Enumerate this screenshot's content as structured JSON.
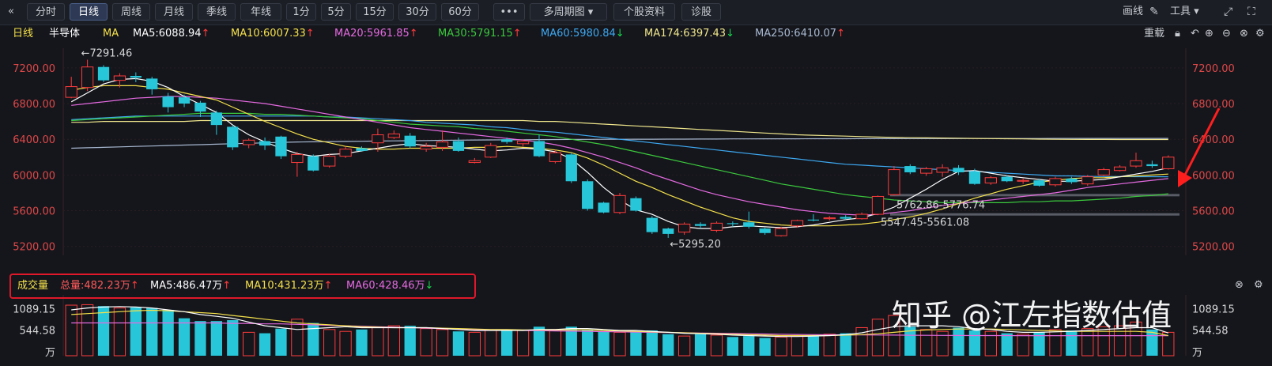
{
  "toolbar": {
    "collapse_icon": "«",
    "buttons": [
      "分时",
      "日线",
      "周线",
      "月线",
      "季线",
      "年线",
      "1分",
      "5分",
      "15分",
      "30分",
      "60分",
      "•••",
      "多周期图 ▾",
      "个股资料",
      "诊股"
    ],
    "active": "日线",
    "right": {
      "draw": "画线",
      "tools": "工具 ▾"
    }
  },
  "ma_header": {
    "period": "日线",
    "name": "半导体",
    "ma_label": "MA",
    "items": [
      {
        "label": "MA5:6088.94",
        "color": "#ffffff",
        "arrow": "↑",
        "dir": "up"
      },
      {
        "label": "MA10:6007.33",
        "color": "#f5e04a",
        "arrow": "↑",
        "dir": "up"
      },
      {
        "label": "MA20:5961.85",
        "color": "#e66ae0",
        "arrow": "↑",
        "dir": "up"
      },
      {
        "label": "MA30:5791.15",
        "color": "#3cc93c",
        "arrow": "↑",
        "dir": "up"
      },
      {
        "label": "MA60:5980.84",
        "color": "#3ea8f0",
        "arrow": "↓",
        "dir": "down"
      },
      {
        "label": "MA174:6397.43",
        "color": "#f0e68c",
        "arrow": "↓",
        "dir": "down"
      },
      {
        "label": "MA250:6410.07",
        "color": "#a8b8d0",
        "arrow": "↑",
        "dir": "up"
      }
    ],
    "reload": "重载"
  },
  "volume_header": {
    "title": "成交量",
    "total": "总量:482.23万",
    "total_arrow": "↑",
    "items": [
      {
        "label": "MA5:486.47万",
        "color": "#ffffff",
        "arrow": "↑",
        "dir": "up"
      },
      {
        "label": "MA10:431.23万",
        "color": "#f5e04a",
        "arrow": "↑",
        "dir": "up"
      },
      {
        "label": "MA60:428.46万",
        "color": "#e66ae0",
        "arrow": "↓",
        "dir": "down"
      }
    ]
  },
  "watermark": "知乎 @江左指数估值",
  "chart_data": {
    "type": "candlestick",
    "ylim": [
      5100,
      7420
    ],
    "y_ticks": [
      "7200.00",
      "6800.00",
      "6400.00",
      "6000.00",
      "5600.00",
      "5200.00"
    ],
    "annotations": {
      "high": "←7291.46",
      "low": "←5295.20",
      "level1": "5762.86-5776.74",
      "level2": "5547.45-5561.08"
    },
    "levels": [
      5770,
      5554
    ],
    "candles": [
      [
        6870,
        6990,
        6860,
        7100
      ],
      [
        6980,
        7210,
        6940,
        7291.46
      ],
      [
        7210,
        7060,
        7040,
        7230
      ],
      [
        7060,
        7110,
        6980,
        7140
      ],
      [
        7110,
        7090,
        7040,
        7150
      ],
      [
        7080,
        6960,
        6900,
        7100
      ],
      [
        6880,
        6760,
        6700,
        6920
      ],
      [
        6870,
        6800,
        6760,
        6900
      ],
      [
        6810,
        6710,
        6650,
        6830
      ],
      [
        6700,
        6560,
        6450,
        6720
      ],
      [
        6540,
        6310,
        6280,
        6560
      ],
      [
        6340,
        6390,
        6300,
        6410
      ],
      [
        6380,
        6330,
        6280,
        6420
      ],
      [
        6430,
        6210,
        6180,
        6440
      ],
      [
        6140,
        6230,
        5980,
        6260
      ],
      [
        6210,
        6050,
        6040,
        6230
      ],
      [
        6100,
        6210,
        6080,
        6240
      ],
      [
        6210,
        6290,
        6190,
        6320
      ],
      [
        6300,
        6270,
        6260,
        6320
      ],
      [
        6360,
        6450,
        6260,
        6520
      ],
      [
        6420,
        6460,
        6400,
        6500
      ],
      [
        6440,
        6320,
        6300,
        6470
      ],
      [
        6290,
        6320,
        6260,
        6360
      ],
      [
        6310,
        6370,
        6270,
        6500
      ],
      [
        6380,
        6270,
        6260,
        6420
      ],
      [
        6140,
        6160,
        6130,
        6190
      ],
      [
        6200,
        6330,
        6190,
        6360
      ],
      [
        6400,
        6370,
        6350,
        6420
      ],
      [
        6350,
        6380,
        6320,
        6400
      ],
      [
        6380,
        6210,
        6200,
        6450
      ],
      [
        6150,
        6250,
        6130,
        6280
      ],
      [
        6230,
        5930,
        5910,
        6250
      ],
      [
        5930,
        5620,
        5600,
        5950
      ],
      [
        5690,
        5580,
        5570,
        5700
      ],
      [
        5580,
        5770,
        5560,
        5800
      ],
      [
        5740,
        5600,
        5590,
        5760
      ],
      [
        5520,
        5360,
        5340,
        5540
      ],
      [
        5400,
        5340,
        5295.2,
        5410
      ],
      [
        5360,
        5450,
        5330,
        5470
      ],
      [
        5450,
        5430,
        5400,
        5470
      ],
      [
        5380,
        5460,
        5360,
        5480
      ],
      [
        5460,
        5450,
        5420,
        5480
      ],
      [
        5470,
        5420,
        5400,
        5590
      ],
      [
        5400,
        5350,
        5330,
        5410
      ],
      [
        5320,
        5400,
        5310,
        5420
      ],
      [
        5430,
        5490,
        5410,
        5500
      ],
      [
        5500,
        5490,
        5480,
        5560
      ],
      [
        5510,
        5520,
        5490,
        5540
      ],
      [
        5530,
        5510,
        5500,
        5550
      ],
      [
        5510,
        5560,
        5500,
        5580
      ],
      [
        5560,
        5760,
        5550,
        5770
      ],
      [
        5780,
        6060,
        5770,
        6100
      ],
      [
        6100,
        6030,
        6010,
        6120
      ],
      [
        6020,
        6070,
        5990,
        6090
      ],
      [
        6030,
        6080,
        5980,
        6120
      ],
      [
        6080,
        6030,
        6000,
        6110
      ],
      [
        6040,
        5900,
        5890,
        6070
      ],
      [
        5910,
        5970,
        5890,
        5990
      ],
      [
        5980,
        5930,
        5920,
        6000
      ],
      [
        5930,
        5940,
        5900,
        5960
      ],
      [
        5940,
        5880,
        5870,
        5960
      ],
      [
        5890,
        5960,
        5870,
        5980
      ],
      [
        5960,
        5920,
        5900,
        5980
      ],
      [
        5900,
        5980,
        5880,
        6000
      ],
      [
        6000,
        6060,
        5990,
        6080
      ],
      [
        6050,
        6090,
        6040,
        6110
      ],
      [
        6100,
        6160,
        6080,
        6250
      ],
      [
        6120,
        6100,
        6080,
        6160
      ],
      [
        6070,
        6200,
        6060,
        6220
      ]
    ],
    "ma5": [
      6820,
      6920,
      7020,
      7070,
      7080,
      7050,
      6980,
      6880,
      6790,
      6700,
      6560,
      6450,
      6370,
      6300,
      6240,
      6210,
      6230,
      6240,
      6270,
      6300,
      6330,
      6350,
      6330,
      6320,
      6310,
      6290,
      6270,
      6280,
      6300,
      6290,
      6260,
      6180,
      6030,
      5860,
      5720,
      5610,
      5560,
      5480,
      5420,
      5400,
      5400,
      5420,
      5430,
      5420,
      5410,
      5420,
      5440,
      5470,
      5500,
      5520,
      5570,
      5640,
      5740,
      5840,
      5950,
      6040,
      6050,
      6020,
      5990,
      5970,
      5950,
      5930,
      5930,
      5940,
      5950,
      5980,
      6010,
      6040,
      6080
    ],
    "ma10": [
      6950,
      6980,
      7000,
      7000,
      7000,
      6980,
      6960,
      6920,
      6880,
      6840,
      6760,
      6680,
      6600,
      6530,
      6460,
      6400,
      6360,
      6320,
      6300,
      6290,
      6290,
      6300,
      6300,
      6300,
      6300,
      6310,
      6310,
      6320,
      6310,
      6300,
      6280,
      6250,
      6190,
      6110,
      6020,
      5930,
      5860,
      5780,
      5710,
      5640,
      5580,
      5520,
      5480,
      5460,
      5440,
      5430,
      5430,
      5430,
      5440,
      5450,
      5470,
      5500,
      5530,
      5570,
      5620,
      5680,
      5740,
      5790,
      5840,
      5880,
      5920,
      5940,
      5960,
      5970,
      5970,
      5980,
      5990,
      6000,
      6010
    ],
    "ma20": [
      6780,
      6800,
      6820,
      6840,
      6860,
      6870,
      6880,
      6880,
      6870,
      6860,
      6840,
      6820,
      6800,
      6770,
      6740,
      6710,
      6680,
      6650,
      6620,
      6590,
      6560,
      6530,
      6510,
      6490,
      6470,
      6450,
      6430,
      6410,
      6390,
      6370,
      6340,
      6300,
      6250,
      6200,
      6140,
      6080,
      6010,
      5950,
      5890,
      5830,
      5780,
      5740,
      5700,
      5670,
      5640,
      5610,
      5590,
      5570,
      5560,
      5550,
      5560,
      5580,
      5600,
      5630,
      5660,
      5680,
      5700,
      5720,
      5740,
      5760,
      5780,
      5800,
      5830,
      5860,
      5880,
      5900,
      5920,
      5940,
      5960
    ],
    "ma30": [
      6610,
      6620,
      6630,
      6640,
      6650,
      6660,
      6670,
      6680,
      6690,
      6690,
      6690,
      6690,
      6680,
      6680,
      6670,
      6660,
      6650,
      6640,
      6630,
      6610,
      6590,
      6570,
      6560,
      6550,
      6540,
      6520,
      6510,
      6490,
      6470,
      6450,
      6430,
      6400,
      6370,
      6340,
      6300,
      6260,
      6220,
      6180,
      6140,
      6100,
      6060,
      6020,
      5980,
      5940,
      5900,
      5870,
      5840,
      5810,
      5780,
      5760,
      5740,
      5720,
      5710,
      5700,
      5690,
      5690,
      5690,
      5690,
      5690,
      5700,
      5700,
      5710,
      5710,
      5720,
      5730,
      5740,
      5760,
      5770,
      5790
    ],
    "ma60": [
      6620,
      6630,
      6640,
      6650,
      6660,
      6660,
      6660,
      6660,
      6660,
      6660,
      6660,
      6660,
      6660,
      6660,
      6660,
      6660,
      6650,
      6650,
      6640,
      6630,
      6620,
      6610,
      6590,
      6580,
      6570,
      6560,
      6540,
      6530,
      6510,
      6490,
      6480,
      6460,
      6440,
      6420,
      6400,
      6380,
      6360,
      6340,
      6320,
      6300,
      6280,
      6260,
      6240,
      6220,
      6200,
      6180,
      6160,
      6140,
      6120,
      6110,
      6100,
      6090,
      6080,
      6070,
      6060,
      6050,
      6040,
      6030,
      6020,
      6010,
      6000,
      5990,
      5990,
      5985,
      5983,
      5982,
      5981,
      5981,
      5980
    ],
    "ma174": [
      6590,
      6590,
      6600,
      6600,
      6600,
      6600,
      6600,
      6600,
      6610,
      6610,
      6610,
      6610,
      6610,
      6610,
      6610,
      6610,
      6610,
      6610,
      6610,
      6610,
      6610,
      6610,
      6610,
      6610,
      6610,
      6610,
      6610,
      6610,
      6610,
      6600,
      6600,
      6590,
      6580,
      6570,
      6560,
      6550,
      6540,
      6530,
      6520,
      6510,
      6500,
      6490,
      6480,
      6470,
      6460,
      6450,
      6445,
      6440,
      6435,
      6430,
      6425,
      6420,
      6418,
      6416,
      6414,
      6412,
      6410,
      6408,
      6406,
      6404,
      6402,
      6400,
      6399,
      6398,
      6398,
      6397,
      6397,
      6397,
      6397
    ],
    "ma250": [
      6300,
      6305,
      6310,
      6315,
      6320,
      6325,
      6330,
      6335,
      6340,
      6345,
      6350,
      6355,
      6360,
      6365,
      6370,
      6372,
      6374,
      6376,
      6378,
      6380,
      6382,
      6384,
      6386,
      6388,
      6390,
      6392,
      6393,
      6394,
      6395,
      6396,
      6397,
      6398,
      6399,
      6400,
      6400,
      6401,
      6401,
      6402,
      6402,
      6403,
      6403,
      6404,
      6404,
      6405,
      6405,
      6405,
      6406,
      6406,
      6406,
      6407,
      6407,
      6407,
      6408,
      6408,
      6408,
      6408,
      6409,
      6409,
      6409,
      6409,
      6409,
      6410,
      6410,
      6410,
      6410,
      6410,
      6410,
      6410,
      6410
    ],
    "volume": {
      "ylim": [
        0,
        1300
      ],
      "y_ticks": [
        "1089.15",
        "544.58",
        "万"
      ],
      "values": [
        1080,
        1090,
        1060,
        1020,
        1030,
        1020,
        980,
        800,
        740,
        740,
        760,
        500,
        480,
        580,
        780,
        700,
        560,
        520,
        560,
        600,
        640,
        640,
        580,
        560,
        520,
        500,
        540,
        560,
        540,
        620,
        560,
        620,
        560,
        520,
        500,
        520,
        540,
        460,
        420,
        460,
        440,
        400,
        420,
        380,
        400,
        420,
        440,
        460,
        480,
        600,
        780,
        860,
        620,
        560,
        520,
        600,
        540,
        520,
        480,
        460,
        500,
        560,
        540,
        580,
        620,
        640,
        720,
        560,
        500
      ],
      "ma5": [
        980,
        1020,
        1040,
        1050,
        1040,
        1020,
        980,
        940,
        880,
        840,
        800,
        720,
        640,
        600,
        560,
        580,
        600,
        620,
        600,
        600,
        600,
        600,
        600,
        580,
        560,
        540,
        540,
        540,
        540,
        560,
        560,
        580,
        580,
        560,
        540,
        540,
        520,
        500,
        480,
        470,
        460,
        440,
        430,
        420,
        410,
        410,
        420,
        430,
        450,
        490,
        560,
        620,
        640,
        640,
        640,
        620,
        580,
        560,
        520,
        500,
        500,
        510,
        520,
        540,
        560,
        580,
        600,
        600,
        486
      ],
      "ma10": [
        880,
        900,
        920,
        940,
        960,
        970,
        960,
        940,
        920,
        900,
        860,
        820,
        780,
        740,
        700,
        680,
        660,
        640,
        620,
        610,
        600,
        600,
        600,
        590,
        580,
        570,
        560,
        560,
        550,
        550,
        550,
        550,
        550,
        540,
        530,
        520,
        510,
        500,
        490,
        480,
        470,
        460,
        450,
        440,
        430,
        430,
        430,
        430,
        440,
        450,
        470,
        500,
        530,
        550,
        560,
        570,
        570,
        570,
        560,
        550,
        540,
        530,
        520,
        520,
        520,
        520,
        520,
        500,
        431
      ],
      "ma60": [
        700,
        700,
        700,
        700,
        700,
        700,
        700,
        700,
        700,
        700,
        690,
        690,
        680,
        680,
        670,
        660,
        650,
        640,
        630,
        620,
        610,
        600,
        590,
        580,
        570,
        560,
        550,
        545,
        540,
        535,
        530,
        525,
        520,
        515,
        510,
        505,
        500,
        495,
        490,
        485,
        480,
        475,
        470,
        465,
        460,
        455,
        450,
        448,
        446,
        444,
        442,
        440,
        438,
        436,
        434,
        432,
        430,
        430,
        430,
        429,
        429,
        429,
        429,
        429,
        428,
        428,
        428,
        428,
        428
      ]
    }
  }
}
